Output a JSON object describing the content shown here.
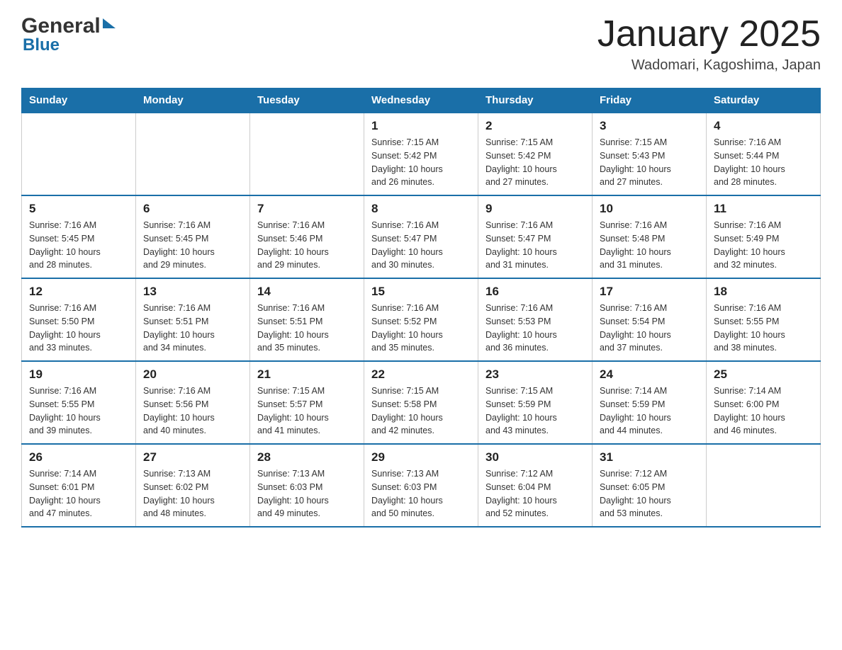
{
  "header": {
    "title": "January 2025",
    "location": "Wadomari, Kagoshima, Japan",
    "logo_general": "General",
    "logo_blue": "Blue"
  },
  "weekdays": [
    "Sunday",
    "Monday",
    "Tuesday",
    "Wednesday",
    "Thursday",
    "Friday",
    "Saturday"
  ],
  "weeks": [
    [
      {
        "day": "",
        "info": ""
      },
      {
        "day": "",
        "info": ""
      },
      {
        "day": "",
        "info": ""
      },
      {
        "day": "1",
        "info": "Sunrise: 7:15 AM\nSunset: 5:42 PM\nDaylight: 10 hours\nand 26 minutes."
      },
      {
        "day": "2",
        "info": "Sunrise: 7:15 AM\nSunset: 5:42 PM\nDaylight: 10 hours\nand 27 minutes."
      },
      {
        "day": "3",
        "info": "Sunrise: 7:15 AM\nSunset: 5:43 PM\nDaylight: 10 hours\nand 27 minutes."
      },
      {
        "day": "4",
        "info": "Sunrise: 7:16 AM\nSunset: 5:44 PM\nDaylight: 10 hours\nand 28 minutes."
      }
    ],
    [
      {
        "day": "5",
        "info": "Sunrise: 7:16 AM\nSunset: 5:45 PM\nDaylight: 10 hours\nand 28 minutes."
      },
      {
        "day": "6",
        "info": "Sunrise: 7:16 AM\nSunset: 5:45 PM\nDaylight: 10 hours\nand 29 minutes."
      },
      {
        "day": "7",
        "info": "Sunrise: 7:16 AM\nSunset: 5:46 PM\nDaylight: 10 hours\nand 29 minutes."
      },
      {
        "day": "8",
        "info": "Sunrise: 7:16 AM\nSunset: 5:47 PM\nDaylight: 10 hours\nand 30 minutes."
      },
      {
        "day": "9",
        "info": "Sunrise: 7:16 AM\nSunset: 5:47 PM\nDaylight: 10 hours\nand 31 minutes."
      },
      {
        "day": "10",
        "info": "Sunrise: 7:16 AM\nSunset: 5:48 PM\nDaylight: 10 hours\nand 31 minutes."
      },
      {
        "day": "11",
        "info": "Sunrise: 7:16 AM\nSunset: 5:49 PM\nDaylight: 10 hours\nand 32 minutes."
      }
    ],
    [
      {
        "day": "12",
        "info": "Sunrise: 7:16 AM\nSunset: 5:50 PM\nDaylight: 10 hours\nand 33 minutes."
      },
      {
        "day": "13",
        "info": "Sunrise: 7:16 AM\nSunset: 5:51 PM\nDaylight: 10 hours\nand 34 minutes."
      },
      {
        "day": "14",
        "info": "Sunrise: 7:16 AM\nSunset: 5:51 PM\nDaylight: 10 hours\nand 35 minutes."
      },
      {
        "day": "15",
        "info": "Sunrise: 7:16 AM\nSunset: 5:52 PM\nDaylight: 10 hours\nand 35 minutes."
      },
      {
        "day": "16",
        "info": "Sunrise: 7:16 AM\nSunset: 5:53 PM\nDaylight: 10 hours\nand 36 minutes."
      },
      {
        "day": "17",
        "info": "Sunrise: 7:16 AM\nSunset: 5:54 PM\nDaylight: 10 hours\nand 37 minutes."
      },
      {
        "day": "18",
        "info": "Sunrise: 7:16 AM\nSunset: 5:55 PM\nDaylight: 10 hours\nand 38 minutes."
      }
    ],
    [
      {
        "day": "19",
        "info": "Sunrise: 7:16 AM\nSunset: 5:55 PM\nDaylight: 10 hours\nand 39 minutes."
      },
      {
        "day": "20",
        "info": "Sunrise: 7:16 AM\nSunset: 5:56 PM\nDaylight: 10 hours\nand 40 minutes."
      },
      {
        "day": "21",
        "info": "Sunrise: 7:15 AM\nSunset: 5:57 PM\nDaylight: 10 hours\nand 41 minutes."
      },
      {
        "day": "22",
        "info": "Sunrise: 7:15 AM\nSunset: 5:58 PM\nDaylight: 10 hours\nand 42 minutes."
      },
      {
        "day": "23",
        "info": "Sunrise: 7:15 AM\nSunset: 5:59 PM\nDaylight: 10 hours\nand 43 minutes."
      },
      {
        "day": "24",
        "info": "Sunrise: 7:14 AM\nSunset: 5:59 PM\nDaylight: 10 hours\nand 44 minutes."
      },
      {
        "day": "25",
        "info": "Sunrise: 7:14 AM\nSunset: 6:00 PM\nDaylight: 10 hours\nand 46 minutes."
      }
    ],
    [
      {
        "day": "26",
        "info": "Sunrise: 7:14 AM\nSunset: 6:01 PM\nDaylight: 10 hours\nand 47 minutes."
      },
      {
        "day": "27",
        "info": "Sunrise: 7:13 AM\nSunset: 6:02 PM\nDaylight: 10 hours\nand 48 minutes."
      },
      {
        "day": "28",
        "info": "Sunrise: 7:13 AM\nSunset: 6:03 PM\nDaylight: 10 hours\nand 49 minutes."
      },
      {
        "day": "29",
        "info": "Sunrise: 7:13 AM\nSunset: 6:03 PM\nDaylight: 10 hours\nand 50 minutes."
      },
      {
        "day": "30",
        "info": "Sunrise: 7:12 AM\nSunset: 6:04 PM\nDaylight: 10 hours\nand 52 minutes."
      },
      {
        "day": "31",
        "info": "Sunrise: 7:12 AM\nSunset: 6:05 PM\nDaylight: 10 hours\nand 53 minutes."
      },
      {
        "day": "",
        "info": ""
      }
    ]
  ]
}
